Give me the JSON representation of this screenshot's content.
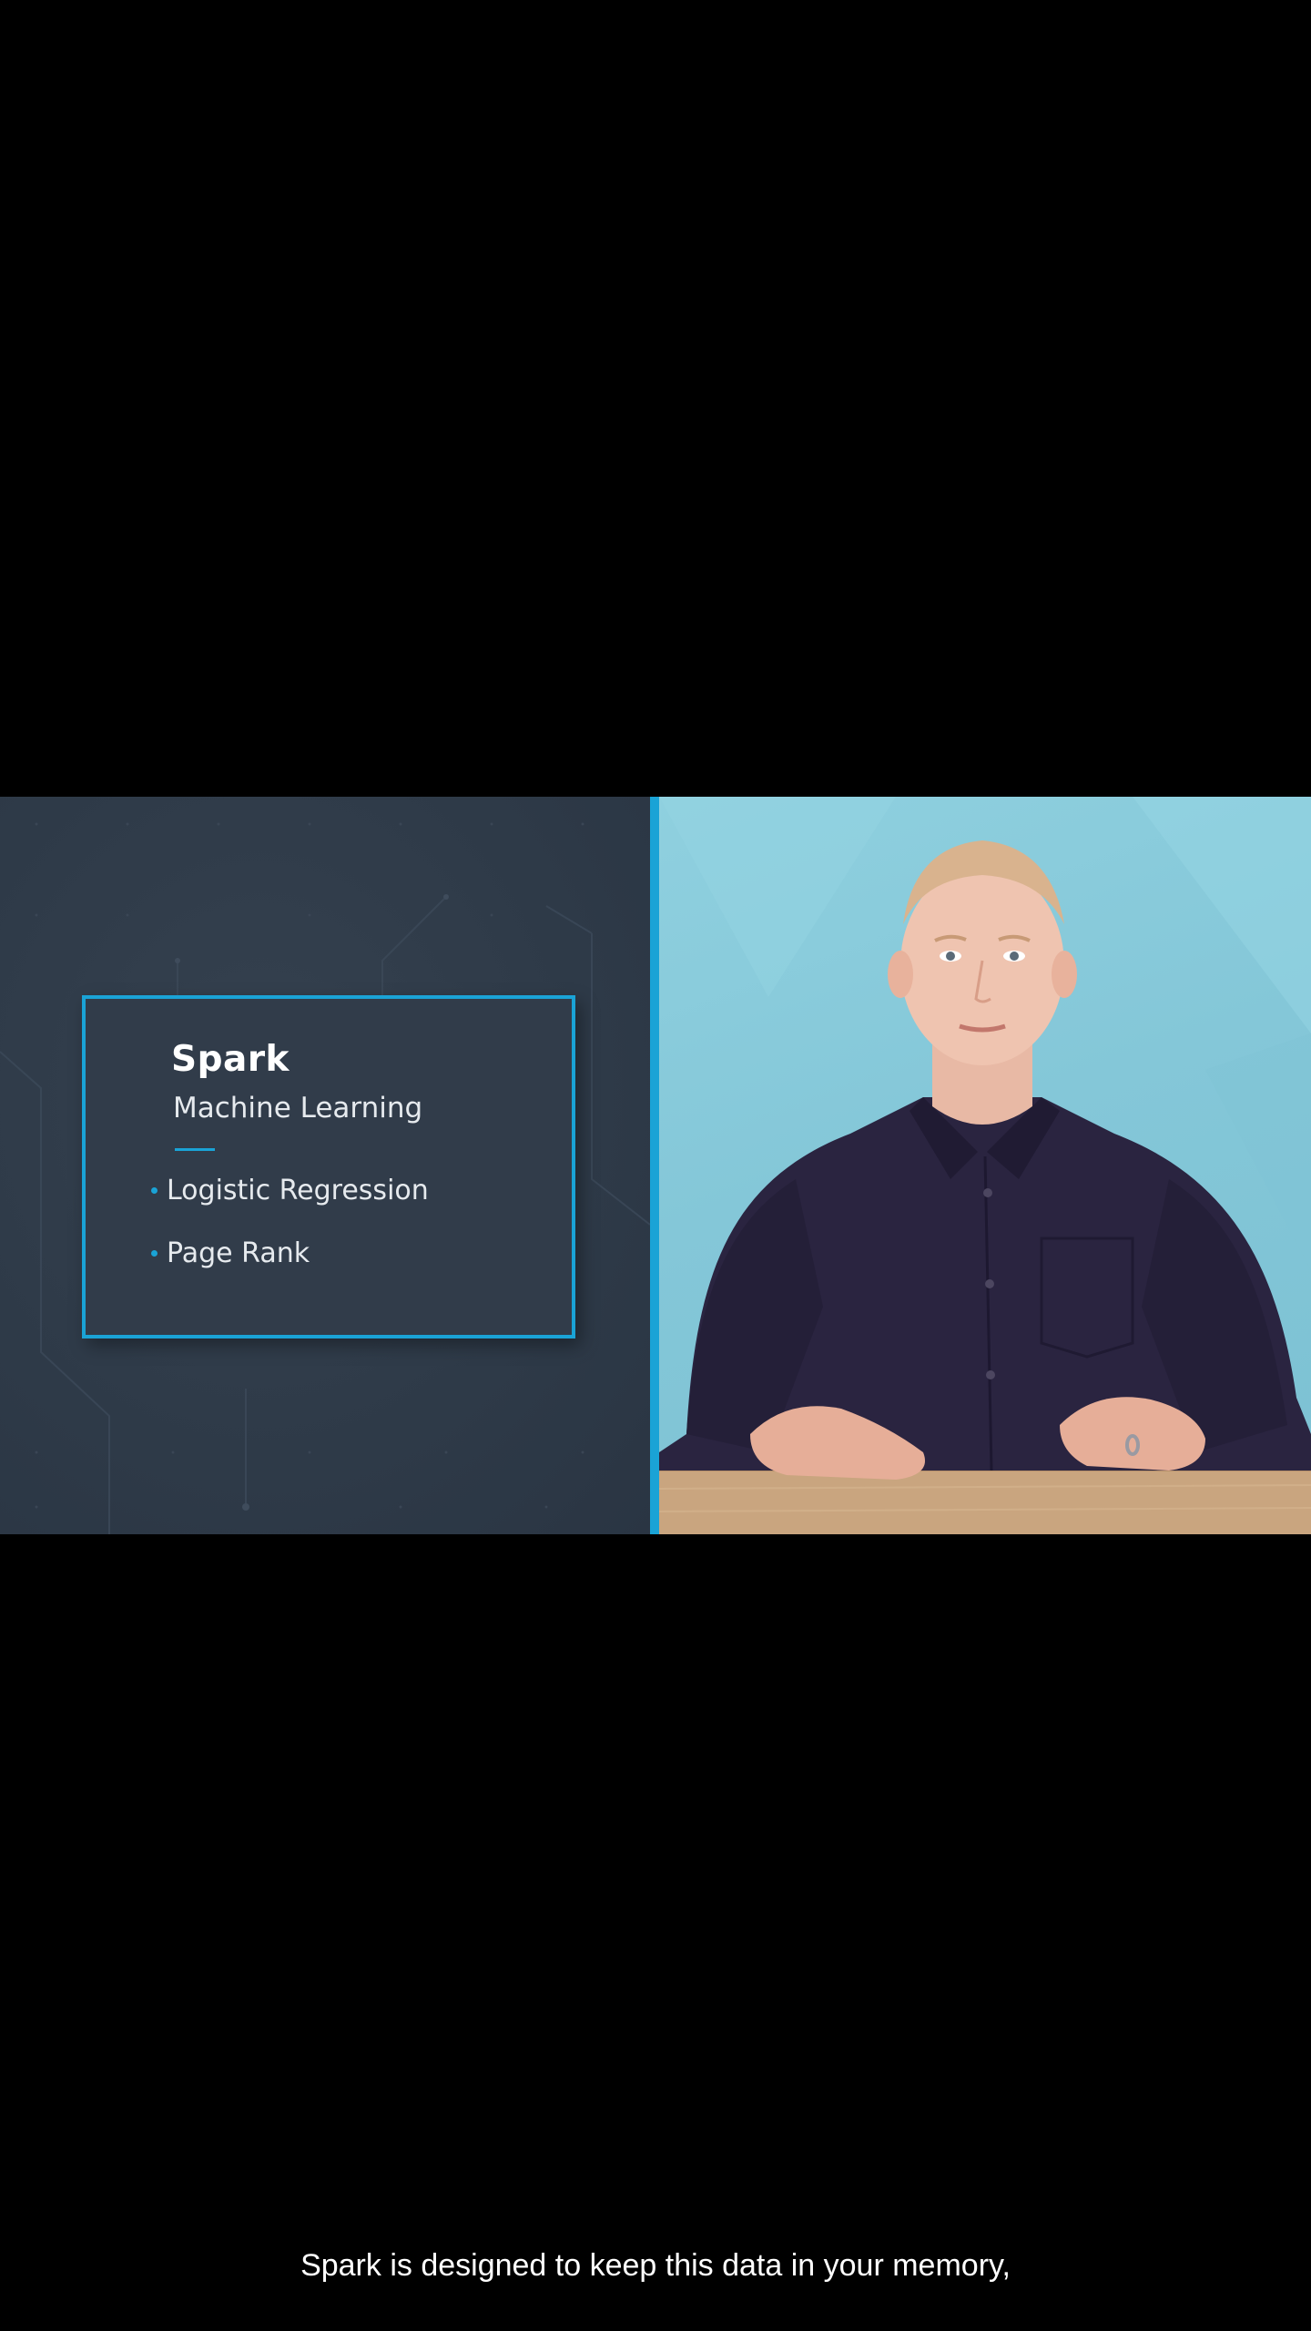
{
  "slide": {
    "title": "Spark",
    "subtitle": "Machine Learning",
    "bullets": [
      {
        "label": "Logistic Regression"
      },
      {
        "label": "Page Rank"
      }
    ]
  },
  "caption": {
    "text": "Spark is designed to keep this data in your memory,"
  },
  "colors": {
    "background": "#000000",
    "slide_background": "#2f3b4a",
    "accent": "#1aa3d6",
    "presenter_backdrop": "#88cadb",
    "text": "#ffffff"
  }
}
